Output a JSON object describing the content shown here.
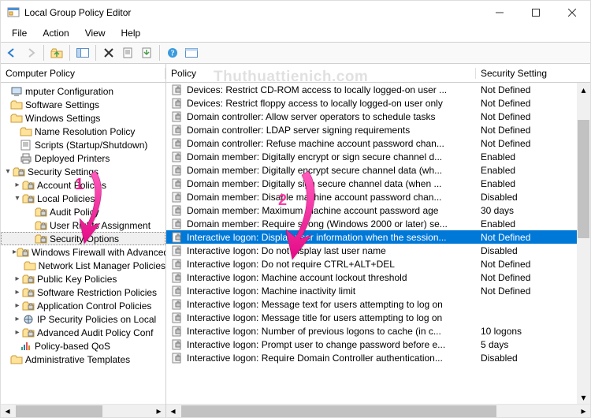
{
  "window": {
    "title": "Local Group Policy Editor"
  },
  "menu": {
    "file": "File",
    "action": "Action",
    "view": "View",
    "help": "Help"
  },
  "watermark": "Thuthuattienich.com",
  "tree_header": "Computer Policy",
  "list_header": {
    "policy": "Policy",
    "setting": "Security Setting"
  },
  "tree": [
    {
      "indent": -8,
      "twisty": "",
      "icon": "computer",
      "label": "mputer Configuration"
    },
    {
      "indent": -8,
      "twisty": "",
      "icon": "folder",
      "label": "Software Settings"
    },
    {
      "indent": -8,
      "twisty": "",
      "icon": "folder",
      "label": "Windows Settings"
    },
    {
      "indent": 4,
      "twisty": "",
      "icon": "folder",
      "label": "Name Resolution Policy"
    },
    {
      "indent": 4,
      "twisty": "",
      "icon": "script",
      "label": "Scripts (Startup/Shutdown)"
    },
    {
      "indent": 4,
      "twisty": "",
      "icon": "printer",
      "label": "Deployed Printers"
    },
    {
      "indent": -5,
      "twisty": "▾",
      "icon": "secfolder",
      "label": "Security Settings"
    },
    {
      "indent": 7,
      "twisty": "▸",
      "icon": "secfolder",
      "label": "Account Policies"
    },
    {
      "indent": 7,
      "twisty": "▾",
      "icon": "secfolder",
      "label": "Local Policies"
    },
    {
      "indent": 23,
      "twisty": "",
      "icon": "secfolder",
      "label": "Audit Policy"
    },
    {
      "indent": 23,
      "twisty": "",
      "icon": "secfolder",
      "label": "User Rights Assignment"
    },
    {
      "indent": 23,
      "twisty": "",
      "icon": "secfolder",
      "label": "Security Options",
      "selected": true
    },
    {
      "indent": 7,
      "twisty": "▸",
      "icon": "secfolder",
      "label": "Windows Firewall with Advanced"
    },
    {
      "indent": 19,
      "twisty": "",
      "icon": "folder",
      "label": "Network List Manager Policies"
    },
    {
      "indent": 7,
      "twisty": "▸",
      "icon": "secfolder",
      "label": "Public Key Policies"
    },
    {
      "indent": 7,
      "twisty": "▸",
      "icon": "secfolder",
      "label": "Software Restriction Policies"
    },
    {
      "indent": 7,
      "twisty": "▸",
      "icon": "secfolder",
      "label": "Application Control Policies"
    },
    {
      "indent": 7,
      "twisty": "▸",
      "icon": "ipsec",
      "label": "IP Security Policies on Local"
    },
    {
      "indent": 7,
      "twisty": "▸",
      "icon": "secfolder",
      "label": "Advanced Audit Policy Conf"
    },
    {
      "indent": 4,
      "twisty": "",
      "icon": "qos",
      "label": "Policy-based QoS"
    },
    {
      "indent": -8,
      "twisty": "",
      "icon": "folder",
      "label": "Administrative Templates"
    }
  ],
  "list": [
    {
      "policy": "Devices: Restrict CD-ROM access to locally logged-on user ...",
      "setting": "Not Defined"
    },
    {
      "policy": "Devices: Restrict floppy access to locally logged-on user only",
      "setting": "Not Defined"
    },
    {
      "policy": "Domain controller: Allow server operators to schedule tasks",
      "setting": "Not Defined"
    },
    {
      "policy": "Domain controller: LDAP server signing requirements",
      "setting": "Not Defined"
    },
    {
      "policy": "Domain controller: Refuse machine account password chan...",
      "setting": "Not Defined"
    },
    {
      "policy": "Domain member: Digitally encrypt or sign secure channel d...",
      "setting": "Enabled"
    },
    {
      "policy": "Domain member: Digitally encrypt secure channel data (wh...",
      "setting": "Enabled"
    },
    {
      "policy": "Domain member: Digitally sign secure channel data (when ...",
      "setting": "Enabled"
    },
    {
      "policy": "Domain member: Disable machine account password chan...",
      "setting": "Disabled"
    },
    {
      "policy": "Domain member: Maximum machine account password age",
      "setting": "30 days"
    },
    {
      "policy": "Domain member: Require strong (Windows 2000 or later) se...",
      "setting": "Enabled"
    },
    {
      "policy": "Interactive logon: Display user information when the session...",
      "setting": "Not Defined",
      "selected": true
    },
    {
      "policy": "Interactive logon: Do not display last user name",
      "setting": "Disabled"
    },
    {
      "policy": "Interactive logon: Do not require CTRL+ALT+DEL",
      "setting": "Not Defined"
    },
    {
      "policy": "Interactive logon: Machine account lockout threshold",
      "setting": "Not Defined"
    },
    {
      "policy": "Interactive logon: Machine inactivity limit",
      "setting": "Not Defined"
    },
    {
      "policy": "Interactive logon: Message text for users attempting to log on",
      "setting": ""
    },
    {
      "policy": "Interactive logon: Message title for users attempting to log on",
      "setting": ""
    },
    {
      "policy": "Interactive logon: Number of previous logons to cache (in c...",
      "setting": "10 logons"
    },
    {
      "policy": "Interactive logon: Prompt user to change password before e...",
      "setting": "5 days"
    },
    {
      "policy": "Interactive logon: Require Domain Controller authentication...",
      "setting": "Disabled"
    }
  ],
  "annotations": {
    "num1": "1",
    "num2": "2"
  }
}
